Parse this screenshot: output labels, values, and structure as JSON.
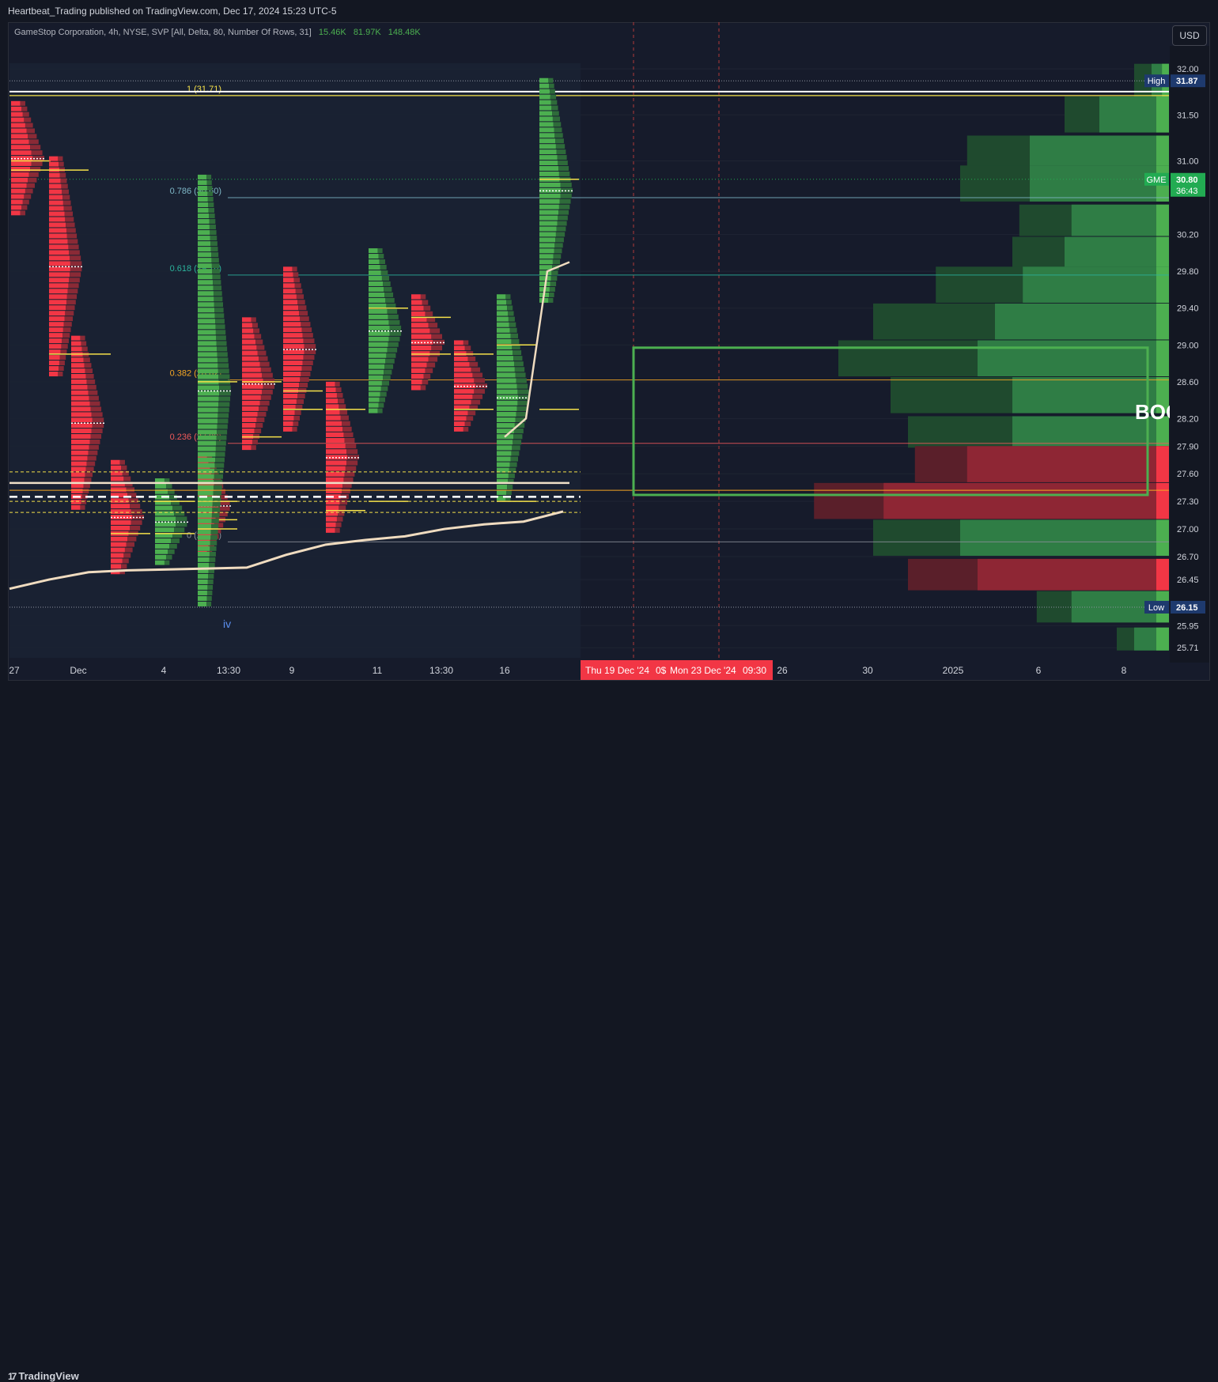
{
  "header": {
    "published": "Heartbeat_Trading published on TradingView.com, Dec 17, 2024 15:23 UTC-5",
    "legend_title": "GameStop Corporation, 4h, NYSE, SVP [All, Delta, 80, Number Of Rows, 31]",
    "legend_values": [
      "15.46K",
      "81.97K",
      "148.48K"
    ],
    "currency": "USD"
  },
  "footer": {
    "brand": "TradingView"
  },
  "chart_data": {
    "type": "candlestick",
    "symbol": "GME",
    "interval": "4h",
    "price_axis": {
      "ticks": [
        "32.00",
        "31.50",
        "31.00",
        "30.20",
        "29.80",
        "29.40",
        "29.00",
        "28.60",
        "28.20",
        "27.90",
        "27.60",
        "27.30",
        "27.00",
        "26.70",
        "26.45",
        "25.95",
        "25.71"
      ],
      "ylim": [
        25.6,
        32.25
      ],
      "badges": [
        {
          "label": "High",
          "value": "31.87",
          "color": "#1e3a6e"
        },
        {
          "label": "GME",
          "value": "30.80",
          "extra": "36:43",
          "color": "#22ab52"
        },
        {
          "label": "Low",
          "value": "26.15",
          "color": "#1e3a6e"
        }
      ]
    },
    "time_axis": {
      "labels": [
        "27",
        "Dec",
        "4",
        "13:30",
        "9",
        "11",
        "13:30",
        "16",
        "26",
        "30",
        "2025",
        "6",
        "8"
      ],
      "highlighted": [
        "Thu 19 Dec '24",
        "0$",
        "Mon 23 Dec '24",
        "09:30"
      ]
    },
    "fibonacci": [
      {
        "label": "1 (31.71)",
        "level": 31.71,
        "color": "#f5e14a"
      },
      {
        "label": "0.786 (30.60)",
        "level": 30.6,
        "color": "#7fb8c8"
      },
      {
        "label": "0.618 (29.76)",
        "level": 29.76,
        "color": "#2bb39c"
      },
      {
        "label": "0.382 (28.62)",
        "level": 28.62,
        "color": "#f5a623"
      },
      {
        "label": "0.236 (27.93)",
        "level": 27.93,
        "color": "#f05a5a"
      },
      {
        "label": "0 (26.86)",
        "level": 26.86,
        "color": "#8a8f99"
      }
    ],
    "segments": [
      {
        "open": 31.0,
        "high": 31.65,
        "low": 30.4,
        "close": 30.9
      },
      {
        "open": 30.9,
        "high": 31.05,
        "low": 28.65,
        "close": 28.9
      },
      {
        "open": 28.9,
        "high": 29.1,
        "low": 27.2,
        "close": 27.5
      },
      {
        "open": 27.5,
        "high": 27.75,
        "low": 26.5,
        "close": 26.95
      },
      {
        "open": 26.95,
        "high": 27.55,
        "low": 26.6,
        "close": 27.3
      },
      {
        "open": 27.3,
        "high": 27.8,
        "low": 26.7,
        "close": 27.1
      },
      {
        "open": 27.0,
        "high": 30.85,
        "low": 26.15,
        "close": 28.6
      },
      {
        "open": 28.6,
        "high": 29.3,
        "low": 27.85,
        "close": 28.0
      },
      {
        "open": 28.5,
        "high": 29.85,
        "low": 28.05,
        "close": 28.3
      },
      {
        "open": 28.3,
        "high": 28.6,
        "low": 26.95,
        "close": 27.2
      },
      {
        "open": 27.3,
        "high": 30.05,
        "low": 28.25,
        "close": 29.4
      },
      {
        "open": 29.3,
        "high": 29.55,
        "low": 28.5,
        "close": 28.9
      },
      {
        "open": 28.9,
        "high": 29.05,
        "low": 28.05,
        "close": 28.3
      },
      {
        "open": 27.3,
        "high": 29.55,
        "low": 27.3,
        "close": 29.0
      },
      {
        "open": 28.3,
        "high": 31.9,
        "low": 29.45,
        "close": 30.8
      }
    ],
    "volume_profile": [
      {
        "price": 31.87,
        "buy": 0.05,
        "sell": 0.05
      },
      {
        "price": 31.5,
        "buy": 0.2,
        "sell": 0.1
      },
      {
        "price": 31.1,
        "buy": 0.4,
        "sell": 0.18
      },
      {
        "price": 30.75,
        "buy": 0.4,
        "sell": 0.2
      },
      {
        "price": 30.35,
        "buy": 0.28,
        "sell": 0.15
      },
      {
        "price": 30.0,
        "buy": 0.3,
        "sell": 0.15
      },
      {
        "price": 29.65,
        "buy": 0.42,
        "sell": 0.25
      },
      {
        "price": 29.25,
        "buy": 0.5,
        "sell": 0.35
      },
      {
        "price": 28.85,
        "buy": 0.55,
        "sell": 0.4
      },
      {
        "price": 28.45,
        "buy": 0.45,
        "sell": 0.35
      },
      {
        "price": 28.05,
        "buy": 0.45,
        "sell": 0.3
      },
      {
        "price": 27.7,
        "buy": 0.15,
        "sell": 0.58
      },
      {
        "price": 27.3,
        "buy": 0.2,
        "sell": 0.82
      },
      {
        "price": 26.9,
        "buy": 0.6,
        "sell": 0.25
      },
      {
        "price": 26.5,
        "buy": 0.2,
        "sell": 0.55
      },
      {
        "price": 26.15,
        "buy": 0.28,
        "sell": 0.1
      },
      {
        "price": 25.8,
        "buy": 0.1,
        "sell": 0.05
      }
    ],
    "ma_line": [
      {
        "bar": 0,
        "v": 26.35
      },
      {
        "bar": 1,
        "v": 26.45
      },
      {
        "bar": 2,
        "v": 26.53
      },
      {
        "bar": 3,
        "v": 26.55
      },
      {
        "bar": 4,
        "v": 26.56
      },
      {
        "bar": 5,
        "v": 26.57
      },
      {
        "bar": 6,
        "v": 26.58
      },
      {
        "bar": 7,
        "v": 26.72
      },
      {
        "bar": 8,
        "v": 26.83
      },
      {
        "bar": 9,
        "v": 26.88
      },
      {
        "bar": 10,
        "v": 26.92
      },
      {
        "bar": 11,
        "v": 27.0
      },
      {
        "bar": 12,
        "v": 27.05
      },
      {
        "bar": 13,
        "v": 27.08
      },
      {
        "bar": 14,
        "v": 27.19
      }
    ],
    "vwap_line": [
      {
        "bar": 13,
        "v": 28.0
      },
      {
        "bar": 14,
        "v": 29.9
      }
    ],
    "box": {
      "from": "Thu 19 Dec '24",
      "top": 28.97,
      "bottom": 27.37,
      "color": "#4caf50"
    },
    "watermark": "BOO",
    "annotation": "iv"
  }
}
